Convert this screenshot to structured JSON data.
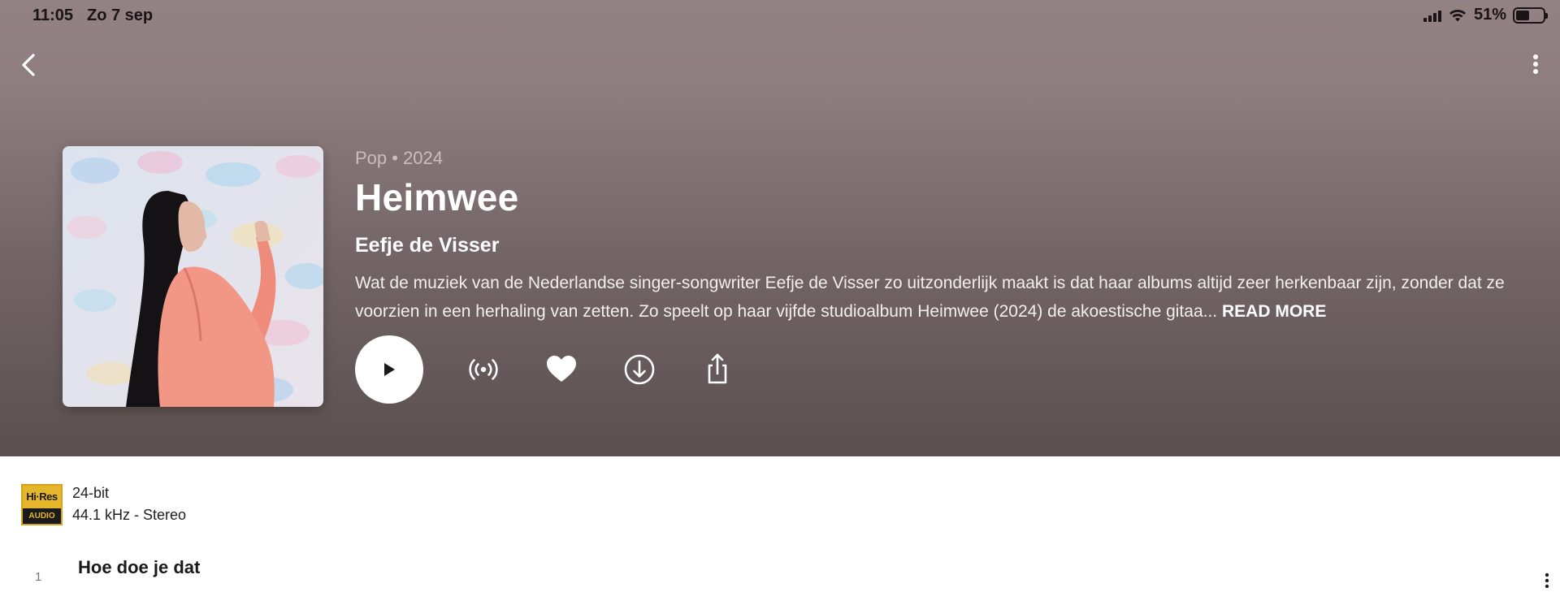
{
  "status_bar": {
    "time": "11:05",
    "date": "Zo 7 sep",
    "battery_percent": "51%",
    "battery_level": 0.51,
    "icons": [
      "cellular-signal-icon",
      "wifi-icon",
      "battery-icon"
    ]
  },
  "nav": {
    "back_icon": "chevron-left-icon",
    "more_icon": "vertical-ellipsis-icon"
  },
  "album": {
    "genre_year": "Pop • 2024",
    "title": "Heimwee",
    "artist": "Eefje de Visser",
    "description": "Wat de muziek van de Nederlandse singer-songwriter Eefje de Visser zo uitzonderlijk maakt is dat haar albums altijd zeer herkenbaar zijn, zonder dat ze voorzien in een herhaling van zetten. Zo speelt op haar vijfde studioalbum Heimwee (2024) de akoestische gitaa...",
    "read_more": "READ MORE"
  },
  "actions": {
    "icons": [
      "play-icon",
      "radio-broadcast-icon",
      "heart-icon",
      "download-icon",
      "share-icon"
    ]
  },
  "quality": {
    "logo_top": "Hi·Res",
    "logo_bottom": "AUDIO",
    "bit_depth": "24-bit",
    "sample_rate": "44.1 kHz - Stereo"
  },
  "tracks": [
    {
      "number": "1",
      "title": "Hoe doe je dat"
    }
  ],
  "colors": {
    "hero_top": "#938283",
    "hero_bottom": "#5b4f4f",
    "hires_gold": "#e5b52b"
  }
}
